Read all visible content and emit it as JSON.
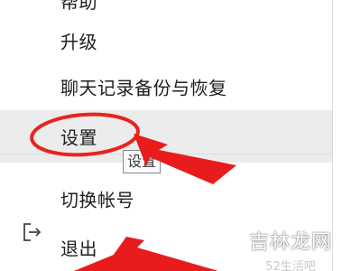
{
  "menu": {
    "items": [
      {
        "label": "帮助"
      },
      {
        "label": "升级"
      },
      {
        "label": "聊天记录备份与恢复"
      },
      {
        "label": "设置"
      },
      {
        "label": "切换帐号"
      },
      {
        "label": "退出"
      }
    ],
    "hovered_item": "设置"
  },
  "tooltip": {
    "text": "设置"
  },
  "annotations": {
    "circle_color": "#e8231f",
    "arrow_color": "#e81c1c"
  },
  "watermark": {
    "main": "吉林龙网",
    "sub": "52生活吧"
  },
  "icons": {
    "logout": "logout-icon",
    "submenu": "chevron-right-icon"
  }
}
